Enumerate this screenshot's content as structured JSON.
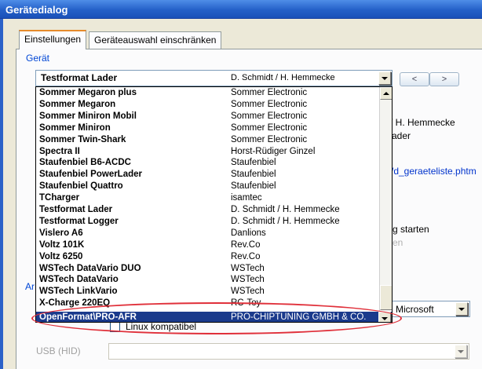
{
  "window": {
    "title": "Gerätedialog"
  },
  "tabs": [
    {
      "label": "Einstellungen",
      "active": true
    },
    {
      "label": "Geräteauswahl einschränken",
      "active": false
    }
  ],
  "group": {
    "label": "Gerät"
  },
  "device_combo": {
    "name": "Testformat Lader",
    "maker": "D. Schmidt / H. Hemmecke"
  },
  "nav": {
    "prev": "<",
    "next": ">"
  },
  "background_text": {
    "maker_partial": "/ H. Hemmecke",
    "type_partial": "ader",
    "link_partial": "/d_geraeteliste.phtm",
    "start_partial": "g starten",
    "grey_partial": "en",
    "left_partial": "Ar"
  },
  "version_combo": {
    "value": "Microsoft"
  },
  "linux_checkbox": {
    "label": "Linux kompatibel"
  },
  "usb": {
    "label": "USB (HID)"
  },
  "device_list": [
    {
      "name": "Sommer Megaron plus",
      "maker": "Sommer Electronic"
    },
    {
      "name": "Sommer Megaron",
      "maker": "Sommer Electronic"
    },
    {
      "name": "Sommer Miniron Mobil",
      "maker": "Sommer Electronic"
    },
    {
      "name": "Sommer Miniron",
      "maker": "Sommer Electronic"
    },
    {
      "name": "Sommer Twin-Shark",
      "maker": "Sommer Electronic"
    },
    {
      "name": "Spectra II",
      "maker": "Horst-Rüdiger Ginzel"
    },
    {
      "name": "Staufenbiel B6-ACDC",
      "maker": "Staufenbiel"
    },
    {
      "name": "Staufenbiel PowerLader",
      "maker": "Staufenbiel"
    },
    {
      "name": "Staufenbiel Quattro",
      "maker": "Staufenbiel"
    },
    {
      "name": "TCharger",
      "maker": "isamtec"
    },
    {
      "name": "Testformat Lader",
      "maker": "D. Schmidt / H. Hemmecke"
    },
    {
      "name": "Testformat Logger",
      "maker": "D. Schmidt / H. Hemmecke"
    },
    {
      "name": "Vislero A6",
      "maker": "Danlions"
    },
    {
      "name": "Voltz 101K",
      "maker": "Rev.Co"
    },
    {
      "name": "Voltz 6250",
      "maker": "Rev.Co"
    },
    {
      "name": "WSTech DataVario DUO",
      "maker": "WSTech"
    },
    {
      "name": "WSTech DataVario",
      "maker": "WSTech"
    },
    {
      "name": "WSTech LinkVario",
      "maker": "WSTech"
    },
    {
      "name": "X-Charge 220EQ",
      "maker": "RC-Toy"
    }
  ],
  "selected_item": {
    "name": "OpenFormat\\PRO-AFR",
    "maker": "PRO-CHIPTUNING GMBH & CO."
  },
  "colors": {
    "title_bar": "#2460c8",
    "selection": "#1a3a8c",
    "annotation": "#e0303a",
    "link": "#0046d5"
  }
}
